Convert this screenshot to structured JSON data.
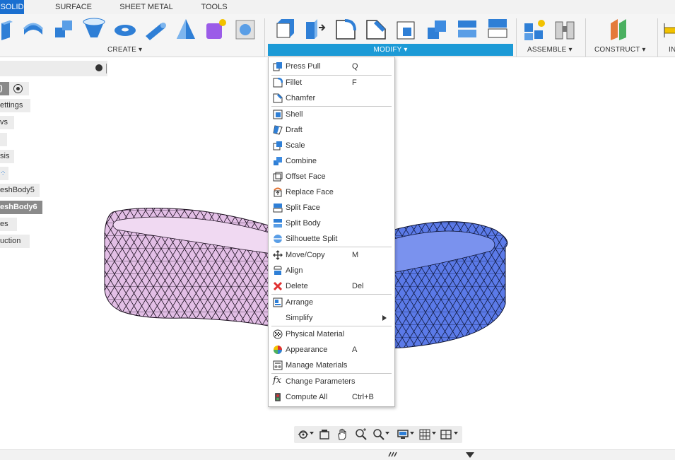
{
  "tabs": {
    "solid": "SOLID",
    "surface": "SURFACE",
    "sheet_metal": "SHEET METAL",
    "tools": "TOOLS"
  },
  "ribbon": {
    "create": "CREATE ▾",
    "modify": "MODIFY ▾",
    "assemble": "ASSEMBLE ▾",
    "construct": "CONSTRUCT ▾",
    "inspect_partial": "IN"
  },
  "browser": {
    "items": [
      {
        "label": ")"
      },
      {
        "label": "ettings"
      },
      {
        "label": "vs"
      },
      {
        "label": ""
      },
      {
        "label": "sis"
      },
      {
        "label": ""
      },
      {
        "label": "eshBody5"
      },
      {
        "label": "eshBody6"
      },
      {
        "label": "es"
      },
      {
        "label": "uction"
      }
    ]
  },
  "menu": {
    "items": [
      {
        "label": "Press Pull",
        "shortcut": "Q"
      },
      {
        "label": "Fillet",
        "shortcut": "F"
      },
      {
        "label": "Chamfer",
        "shortcut": ""
      },
      {
        "label": "Shell",
        "shortcut": ""
      },
      {
        "label": "Draft",
        "shortcut": ""
      },
      {
        "label": "Scale",
        "shortcut": ""
      },
      {
        "label": "Combine",
        "shortcut": ""
      },
      {
        "label": "Offset Face",
        "shortcut": ""
      },
      {
        "label": "Replace Face",
        "shortcut": ""
      },
      {
        "label": "Split Face",
        "shortcut": ""
      },
      {
        "label": "Split Body",
        "shortcut": ""
      },
      {
        "label": "Silhouette Split",
        "shortcut": ""
      },
      {
        "label": "Move/Copy",
        "shortcut": "M"
      },
      {
        "label": "Align",
        "shortcut": ""
      },
      {
        "label": "Delete",
        "shortcut": "Del"
      },
      {
        "label": "Arrange",
        "shortcut": ""
      },
      {
        "label": "Simplify",
        "shortcut": ""
      },
      {
        "label": "Physical Material",
        "shortcut": ""
      },
      {
        "label": "Appearance",
        "shortcut": "A"
      },
      {
        "label": "Manage Materials",
        "shortcut": ""
      },
      {
        "label": "Change Parameters",
        "shortcut": ""
      },
      {
        "label": "Compute All",
        "shortcut": "Ctrl+B"
      }
    ]
  },
  "colors": {
    "accent": "#1a6fd0",
    "modify_active": "#1c9ad6",
    "body_pink": "#e2b6e6",
    "body_blue": "#5a78e8",
    "delete_red": "#e03030"
  }
}
